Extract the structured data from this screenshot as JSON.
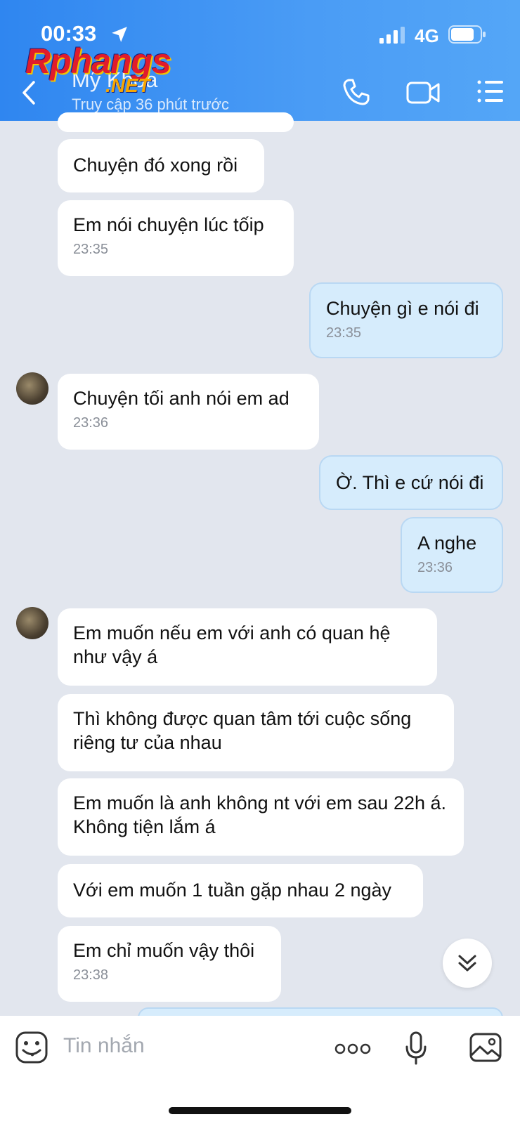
{
  "status_bar": {
    "time": "00:33",
    "network": "4G"
  },
  "watermark": {
    "brand": "Rphangs",
    "suffix": ".NET"
  },
  "header": {
    "contact_name": "Mỹ Khoa",
    "last_seen": "Truy cập 36 phút trước"
  },
  "messages": [
    {
      "text": "Chuyện đó xong rồi",
      "time": ""
    },
    {
      "text": "Em nói chuyện lúc tốip",
      "time": "23:35"
    },
    {
      "text": "Chuyện gì e nói đi",
      "time": "23:35"
    },
    {
      "text": "Chuyện tối anh nói em ad",
      "time": "23:36"
    },
    {
      "text": "Ờ. Thì e cứ nói đi",
      "time": ""
    },
    {
      "text": "A nghe",
      "time": "23:36"
    },
    {
      "text": "Em  muốn nếu em với anh có quan hệ như vậy á",
      "time": ""
    },
    {
      "text": "Thì không được quan tâm tới cuộc sống riêng tư của nhau",
      "time": ""
    },
    {
      "text": "Em muốn là anh không nt với em sau 22h á. Không tiện lắm á",
      "time": ""
    },
    {
      "text": "Với em muốn 1 tuần gặp nhau 2 ngày",
      "time": ""
    },
    {
      "text": "Em chỉ muốn vậy thôi",
      "time": "23:38"
    }
  ],
  "composer": {
    "placeholder": "Tin nhắn"
  },
  "colors": {
    "header": "#3d93f3",
    "outgoing": "#d6ecfc",
    "incoming": "#ffffff",
    "background": "#e2e6ee"
  },
  "icons": [
    "location-arrow-icon",
    "signal-icon",
    "battery-icon",
    "back-icon",
    "phone-icon",
    "video-call-icon",
    "menu-icon",
    "chevron-double-down-icon",
    "sticker-icon",
    "more-icon",
    "microphone-icon",
    "image-icon"
  ]
}
